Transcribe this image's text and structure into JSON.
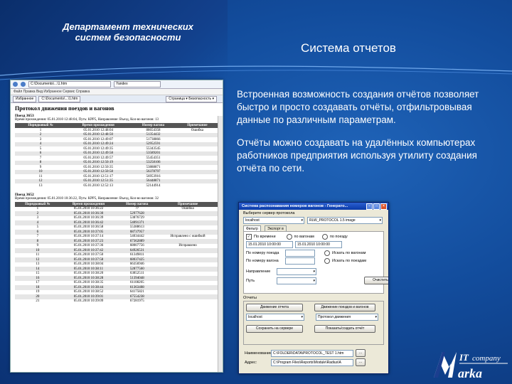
{
  "slide": {
    "department": "Департамент технических систем безопасности",
    "title": "Система отчетов",
    "paragraph1": "Встроенная возможность создания отчётов позволяет быстро и просто создавать отчёты, отфильтровывая данные по различным параметрам.",
    "paragraph2": "Отчёты можно создавать на удалённых компьютерах работников предприятия используя утилиту создания отчёта по сети."
  },
  "browser": {
    "address": "C:\\Documents\\...\\1.htm",
    "search": "Yandex",
    "menu": "Файл  Правка  Вид  Избранное  Сервис  Справка",
    "tab1": "Избранное",
    "tab2": "C:\\Documents\\...\\1.htm",
    "toolbar_right": "Страница ▾  Безопасность ▾"
  },
  "report": {
    "heading": "Протокол движения поездов и вагонов",
    "train1_label": "Поезд 3653",
    "train1_info": "Время прохождения: 05.01.2010 12:48:04, Путь: КРР5, Направление: Въезд, Кол-во вагонов: 13",
    "columns": [
      "Порядковый №",
      "Время прохождения",
      "Номер вагона",
      "Примечание"
    ],
    "train1_rows": [
      [
        "1",
        "05.01.2010 12:48:04",
        "88654358",
        "Ошибка"
      ],
      [
        "2",
        "05.01.2010 12:48:50",
        "51354432",
        ""
      ],
      [
        "3",
        "05.01.2010 12:49:07",
        "51738866",
        ""
      ],
      [
        "4",
        "05.01.2010 12:49:24",
        "52952591",
        ""
      ],
      [
        "5",
        "05.01.2010 12:49:35",
        "55343545",
        ""
      ],
      [
        "6",
        "05.01.2010 12:49:58",
        "53589201",
        ""
      ],
      [
        "7",
        "05.01.2010 12:49:57",
        "55454351",
        ""
      ],
      [
        "8",
        "05.01.2010 12:50:19",
        "53258106",
        ""
      ],
      [
        "9",
        "05.01.2010 12:50:35",
        "53888871",
        ""
      ],
      [
        "10",
        "05.01.2010 12:50:58",
        "56378797",
        ""
      ],
      [
        "11",
        "05.01.2010 12:51:17",
        "56953916",
        ""
      ],
      [
        "12",
        "05.01.2010 12:51:35",
        "56448871",
        ""
      ],
      [
        "13",
        "05.01.2010 12:52:13",
        "52144914",
        ""
      ]
    ],
    "train2_label": "Поезд 3652",
    "train2_info": "Время прохождения: 05.01.2010 10:36:22, Путь: КРР5, Направление: Въезд, Кол-во вагонов: 32",
    "train2_rows": [
      [
        "1",
        "05.01.2010 10:36:22",
        "??",
        "Ошибка"
      ],
      [
        "2",
        "05.01.2010 10:36:30",
        "52977628",
        ""
      ],
      [
        "3",
        "05.01.2010 10:36:39",
        "53876729",
        ""
      ],
      [
        "4",
        "05.01.2010 10:36:42",
        "54091371",
        ""
      ],
      [
        "5",
        "05.01.2010 10:36:58",
        "55388613",
        ""
      ],
      [
        "6",
        "05.01.2010 10:37:05",
        "68737957",
        ""
      ],
      [
        "7",
        "05.01.2010 10:37:14",
        "54034442",
        "Исправлено с ошибкой"
      ],
      [
        "8",
        "05.01.2010 10:37:23",
        "67362889",
        ""
      ],
      [
        "9",
        "05.01.2010 10:37:36",
        "68007756",
        "Исправлено"
      ],
      [
        "10",
        "05.01.2010 10:37:42",
        "64926531",
        ""
      ],
      [
        "11",
        "05.01.2010 10:37:50",
        "61349811",
        ""
      ],
      [
        "12",
        "05.01.2010 10:37:58",
        "68037425",
        ""
      ],
      [
        "13",
        "05.01.2010 10:38:04",
        "66356946",
        ""
      ],
      [
        "14",
        "05.01.2010 10:38:11",
        "52877560",
        ""
      ],
      [
        "15",
        "05.01.2010 10:38:20",
        "63852511",
        ""
      ],
      [
        "16",
        "05.01.2010 10:38:28",
        "51394048",
        ""
      ],
      [
        "17",
        "05.01.2010 10:38:35",
        "61108205",
        ""
      ],
      [
        "18",
        "05.01.2010 10:38:44",
        "61363408",
        ""
      ],
      [
        "19",
        "05.01.2010 10:38:52",
        "64175821",
        ""
      ],
      [
        "20",
        "05.01.2010 10:39:01",
        "67554238",
        ""
      ],
      [
        "21",
        "05.01.2010 10:39:09",
        "67281975",
        ""
      ]
    ]
  },
  "dialog": {
    "title": "Система распознавания номеров вагонов - Генерато...",
    "server_label": "Выберите сервер протокола",
    "server_value": "localhost",
    "protocol_value": "RLW_PROTOCOL 1.5 image",
    "tab_filter": "Фильтр",
    "tab_settings": "Экспорт в",
    "by_date": "По времени",
    "arrival": "по вагонам",
    "by_train": "по поезду",
    "date_from": "15.01.2010 10:00:00",
    "date_to": "15.01.2010 10:00:00",
    "train_number_label": "По номеру поезда",
    "wagon_number_label": "По номеру вагона",
    "opt1": "Искать по вагонам",
    "opt2": "Искать по поездам",
    "direction_label": "Направление",
    "path_label": "Путь",
    "clear_button": "Очистить",
    "reports_label": "Отчеты",
    "report_btn1": "Движение отчета",
    "report_btn2": "Движение поездов и вагонов",
    "report_server": "localhost",
    "report_type": "Протокол движения",
    "gen_btn1": "Сохранить на сервере",
    "gen_btn2": "Показать/создать отчёт",
    "file_label": "Наименование:",
    "file_value": "C:\\FOLDER\\DATA\\PROTOCOL_TEST 1.htm",
    "addr_label": "Адрес:",
    "addr_value": "C:\\Program Files\\Reports\\Module\\Radius\\A"
  },
  "logo": {
    "it": "IT",
    "company": "company",
    "brand": "arka"
  }
}
